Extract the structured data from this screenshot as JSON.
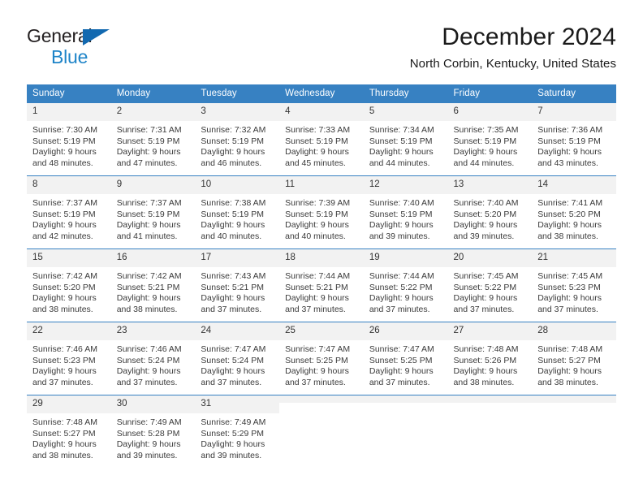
{
  "brand": {
    "line1": "General",
    "line2": "Blue",
    "colors": {
      "dark": "#231f20",
      "blue": "#1e84c8",
      "triangle": "#1269b0"
    }
  },
  "header": {
    "title": "December 2024",
    "subtitle": "North Corbin, Kentucky, United States"
  },
  "theme": {
    "header_bg": "#3781c2",
    "header_text": "#ffffff",
    "daynum_bg": "#f2f2f2",
    "cell_bg": "#ffffff",
    "border": "#3781c2",
    "body_text": "#3a3a3a"
  },
  "weekday_headers": [
    "Sunday",
    "Monday",
    "Tuesday",
    "Wednesday",
    "Thursday",
    "Friday",
    "Saturday"
  ],
  "labels": {
    "sunrise_prefix": "Sunrise:",
    "sunset_prefix": "Sunset:",
    "daylight_prefix": "Daylight:"
  },
  "weeks": [
    [
      {
        "day": "1",
        "l1": "Sunrise: 7:30 AM",
        "l2": "Sunset: 5:19 PM",
        "l3": "Daylight: 9 hours",
        "l4": "and 48 minutes."
      },
      {
        "day": "2",
        "l1": "Sunrise: 7:31 AM",
        "l2": "Sunset: 5:19 PM",
        "l3": "Daylight: 9 hours",
        "l4": "and 47 minutes."
      },
      {
        "day": "3",
        "l1": "Sunrise: 7:32 AM",
        "l2": "Sunset: 5:19 PM",
        "l3": "Daylight: 9 hours",
        "l4": "and 46 minutes."
      },
      {
        "day": "4",
        "l1": "Sunrise: 7:33 AM",
        "l2": "Sunset: 5:19 PM",
        "l3": "Daylight: 9 hours",
        "l4": "and 45 minutes."
      },
      {
        "day": "5",
        "l1": "Sunrise: 7:34 AM",
        "l2": "Sunset: 5:19 PM",
        "l3": "Daylight: 9 hours",
        "l4": "and 44 minutes."
      },
      {
        "day": "6",
        "l1": "Sunrise: 7:35 AM",
        "l2": "Sunset: 5:19 PM",
        "l3": "Daylight: 9 hours",
        "l4": "and 44 minutes."
      },
      {
        "day": "7",
        "l1": "Sunrise: 7:36 AM",
        "l2": "Sunset: 5:19 PM",
        "l3": "Daylight: 9 hours",
        "l4": "and 43 minutes."
      }
    ],
    [
      {
        "day": "8",
        "l1": "Sunrise: 7:37 AM",
        "l2": "Sunset: 5:19 PM",
        "l3": "Daylight: 9 hours",
        "l4": "and 42 minutes."
      },
      {
        "day": "9",
        "l1": "Sunrise: 7:37 AM",
        "l2": "Sunset: 5:19 PM",
        "l3": "Daylight: 9 hours",
        "l4": "and 41 minutes."
      },
      {
        "day": "10",
        "l1": "Sunrise: 7:38 AM",
        "l2": "Sunset: 5:19 PM",
        "l3": "Daylight: 9 hours",
        "l4": "and 40 minutes."
      },
      {
        "day": "11",
        "l1": "Sunrise: 7:39 AM",
        "l2": "Sunset: 5:19 PM",
        "l3": "Daylight: 9 hours",
        "l4": "and 40 minutes."
      },
      {
        "day": "12",
        "l1": "Sunrise: 7:40 AM",
        "l2": "Sunset: 5:19 PM",
        "l3": "Daylight: 9 hours",
        "l4": "and 39 minutes."
      },
      {
        "day": "13",
        "l1": "Sunrise: 7:40 AM",
        "l2": "Sunset: 5:20 PM",
        "l3": "Daylight: 9 hours",
        "l4": "and 39 minutes."
      },
      {
        "day": "14",
        "l1": "Sunrise: 7:41 AM",
        "l2": "Sunset: 5:20 PM",
        "l3": "Daylight: 9 hours",
        "l4": "and 38 minutes."
      }
    ],
    [
      {
        "day": "15",
        "l1": "Sunrise: 7:42 AM",
        "l2": "Sunset: 5:20 PM",
        "l3": "Daylight: 9 hours",
        "l4": "and 38 minutes."
      },
      {
        "day": "16",
        "l1": "Sunrise: 7:42 AM",
        "l2": "Sunset: 5:21 PM",
        "l3": "Daylight: 9 hours",
        "l4": "and 38 minutes."
      },
      {
        "day": "17",
        "l1": "Sunrise: 7:43 AM",
        "l2": "Sunset: 5:21 PM",
        "l3": "Daylight: 9 hours",
        "l4": "and 37 minutes."
      },
      {
        "day": "18",
        "l1": "Sunrise: 7:44 AM",
        "l2": "Sunset: 5:21 PM",
        "l3": "Daylight: 9 hours",
        "l4": "and 37 minutes."
      },
      {
        "day": "19",
        "l1": "Sunrise: 7:44 AM",
        "l2": "Sunset: 5:22 PM",
        "l3": "Daylight: 9 hours",
        "l4": "and 37 minutes."
      },
      {
        "day": "20",
        "l1": "Sunrise: 7:45 AM",
        "l2": "Sunset: 5:22 PM",
        "l3": "Daylight: 9 hours",
        "l4": "and 37 minutes."
      },
      {
        "day": "21",
        "l1": "Sunrise: 7:45 AM",
        "l2": "Sunset: 5:23 PM",
        "l3": "Daylight: 9 hours",
        "l4": "and 37 minutes."
      }
    ],
    [
      {
        "day": "22",
        "l1": "Sunrise: 7:46 AM",
        "l2": "Sunset: 5:23 PM",
        "l3": "Daylight: 9 hours",
        "l4": "and 37 minutes."
      },
      {
        "day": "23",
        "l1": "Sunrise: 7:46 AM",
        "l2": "Sunset: 5:24 PM",
        "l3": "Daylight: 9 hours",
        "l4": "and 37 minutes."
      },
      {
        "day": "24",
        "l1": "Sunrise: 7:47 AM",
        "l2": "Sunset: 5:24 PM",
        "l3": "Daylight: 9 hours",
        "l4": "and 37 minutes."
      },
      {
        "day": "25",
        "l1": "Sunrise: 7:47 AM",
        "l2": "Sunset: 5:25 PM",
        "l3": "Daylight: 9 hours",
        "l4": "and 37 minutes."
      },
      {
        "day": "26",
        "l1": "Sunrise: 7:47 AM",
        "l2": "Sunset: 5:25 PM",
        "l3": "Daylight: 9 hours",
        "l4": "and 37 minutes."
      },
      {
        "day": "27",
        "l1": "Sunrise: 7:48 AM",
        "l2": "Sunset: 5:26 PM",
        "l3": "Daylight: 9 hours",
        "l4": "and 38 minutes."
      },
      {
        "day": "28",
        "l1": "Sunrise: 7:48 AM",
        "l2": "Sunset: 5:27 PM",
        "l3": "Daylight: 9 hours",
        "l4": "and 38 minutes."
      }
    ],
    [
      {
        "day": "29",
        "l1": "Sunrise: 7:48 AM",
        "l2": "Sunset: 5:27 PM",
        "l3": "Daylight: 9 hours",
        "l4": "and 38 minutes."
      },
      {
        "day": "30",
        "l1": "Sunrise: 7:49 AM",
        "l2": "Sunset: 5:28 PM",
        "l3": "Daylight: 9 hours",
        "l4": "and 39 minutes."
      },
      {
        "day": "31",
        "l1": "Sunrise: 7:49 AM",
        "l2": "Sunset: 5:29 PM",
        "l3": "Daylight: 9 hours",
        "l4": "and 39 minutes."
      },
      {
        "day": "",
        "l1": "",
        "l2": "",
        "l3": "",
        "l4": "",
        "blank": true
      },
      {
        "day": "",
        "l1": "",
        "l2": "",
        "l3": "",
        "l4": "",
        "blank": true
      },
      {
        "day": "",
        "l1": "",
        "l2": "",
        "l3": "",
        "l4": "",
        "blank": true
      },
      {
        "day": "",
        "l1": "",
        "l2": "",
        "l3": "",
        "l4": "",
        "blank": true
      }
    ]
  ]
}
